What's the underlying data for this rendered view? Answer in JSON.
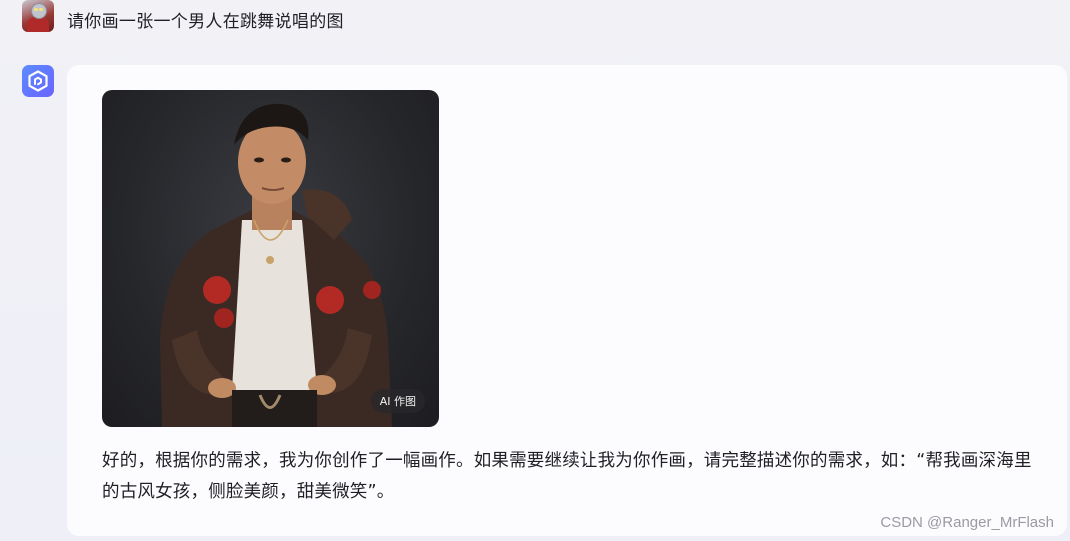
{
  "user": {
    "message": "请你画一张一个男人在跳舞说唱的图"
  },
  "reply": {
    "image_badge": "AI 作图",
    "text": "好的，根据你的需求，我为你创作了一幅画作。如果需要继续让我为你作画，请完整描述你的需求，如：“帮我画深海里的古风女孩，侧脸美颜，甜美微笑”。"
  },
  "watermark": "CSDN @Ranger_MrFlash",
  "colors": {
    "bot_accent": "#6a63ff",
    "page_bg": "#eff0f7",
    "card_bg": "#fcfcfe"
  }
}
